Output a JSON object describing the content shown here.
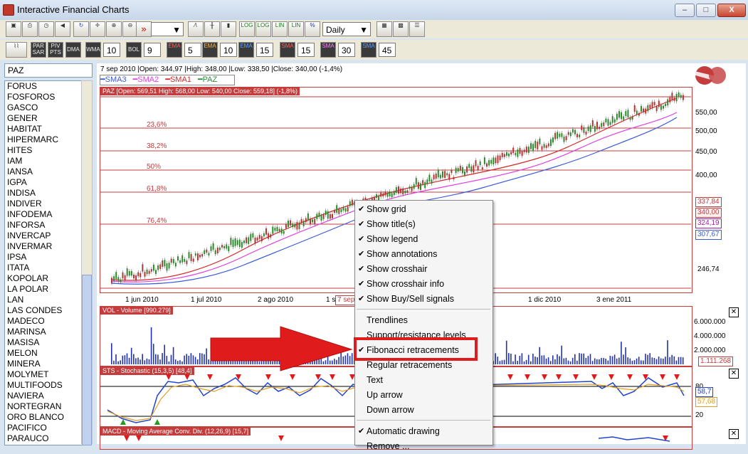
{
  "window": {
    "title": "Interactive Financial Charts",
    "minimize": "–",
    "maximize": "□",
    "close": "X"
  },
  "toolbar1": {
    "zoom_value": "",
    "period": "Daily",
    "icons": [
      "save-icon",
      "print-icon",
      "refresh-icon",
      "speaker-icon",
      "undo-icon",
      "zoom-in-icon",
      "zoom-out-icon",
      "fast-forward-icon"
    ],
    "buttons": [
      "LOG",
      "LOG",
      "LIN",
      "LIN",
      "%"
    ]
  },
  "toolbar2": {
    "labels": [
      "PAR SAR",
      "PIV PTS",
      "DMA",
      "WMA",
      "BOL",
      "EMA",
      "EMA",
      "EMA",
      "SMA",
      "SMA",
      "SMA"
    ],
    "values": [
      "10",
      "9",
      "5",
      "10",
      "15",
      "15",
      "30",
      "45"
    ]
  },
  "symbol_search": "PAZ",
  "symbols": [
    "FORUS",
    "FOSFOROS",
    "GASCO",
    "GENER",
    "HABITAT",
    "HIPERMARC",
    "HITES",
    "IAM",
    "IANSA",
    "IGPA",
    "INDISA",
    "INDIVER",
    "INFODEMA",
    "INFORSA",
    "INVERCAP",
    "INVERMAR",
    "IPSA",
    "ITATA",
    "KOPOLAR",
    "LA POLAR",
    "LAN",
    "LAS CONDES",
    "MADECO",
    "MARINSA",
    "MASISA",
    "MELON",
    "MINERA",
    "MOLYMET",
    "MULTIFOODS",
    "NAVIERA",
    "NORTEGRAN",
    "ORO BLANCO",
    "PACIFICO",
    "PARAUCO"
  ],
  "chart": {
    "info_line": "7 sep 2010 |Open: 344,97 |High: 348,00 |Low: 338,50 |Close: 340,00 (-1,4%)",
    "legend": [
      "SMA3",
      "SMA2",
      "SMA1",
      "PAZ"
    ],
    "legend_colors": [
      "#3b5bdb",
      "#e040e0",
      "#d62828",
      "#2b8a3e"
    ],
    "main_title": "PAZ [Open: 569,51  High: 568,00  Low: 540,00  Close: 559,18] (-1,8%)",
    "fib_levels": [
      "23,6%",
      "38,2%",
      "50%",
      "61,8%",
      "76,4%"
    ],
    "y_ticks": [
      "550,00",
      "500,00",
      "450,00",
      "400,00",
      "246,74"
    ],
    "price_boxes": [
      "337,84",
      "340,00",
      "324,19",
      "307,67"
    ],
    "x_ticks": [
      "1 jun 2010",
      "1 jul 2010",
      "2 ago 2010",
      "1 s",
      "7 sep",
      "1 dic 2010",
      "3 ene 2011"
    ],
    "volume_title": "VOL - Volume [990.279]",
    "volume_ticks": [
      "6.000.000",
      "4.000.000",
      "2.000.000"
    ],
    "volume_box": "1.111.268",
    "stoch_title": "STS - Stochastic (15,3,5) [48,4]",
    "stoch_ticks": [
      "80",
      "20"
    ],
    "stoch_boxes": [
      "58,7",
      "57,68"
    ],
    "macd_title": "MACD - Moving Average Conv. Div. (12,26,9) [15,7]"
  },
  "context_menu": {
    "items": [
      {
        "label": "Show grid",
        "checked": "✔"
      },
      {
        "label": "Show title(s)",
        "checked": "✔"
      },
      {
        "label": "Show legend",
        "checked": "✔"
      },
      {
        "label": "Show annotations",
        "checked": "✔"
      },
      {
        "label": "Show crosshair",
        "checked": "✔"
      },
      {
        "label": "Show crosshair info",
        "checked": "✔"
      },
      {
        "label": "Show Buy/Sell signals",
        "checked": "✔"
      },
      {
        "label": "Trendlines",
        "checked": ""
      },
      {
        "label": "Support/resistance levels",
        "checked": ""
      },
      {
        "label": "Fibonacci retracements",
        "checked": "✔"
      },
      {
        "label": "Regular retracements",
        "checked": ""
      },
      {
        "label": "Text",
        "checked": ""
      },
      {
        "label": "Up arrow",
        "checked": ""
      },
      {
        "label": "Down arrow",
        "checked": ""
      },
      {
        "label": "Automatic drawing",
        "checked": "✔"
      },
      {
        "label": "Remove ...",
        "checked": ""
      }
    ]
  },
  "colors": {
    "accent_red": "#c43c3c",
    "arrow_red": "#e01b1b",
    "candle_green": "#1e9e1e"
  }
}
